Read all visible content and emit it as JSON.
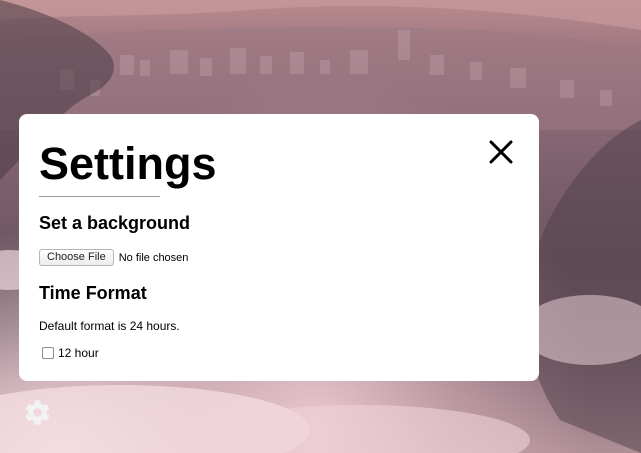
{
  "modal": {
    "title": "Settings",
    "close_icon": "close-icon",
    "background_section": {
      "heading": "Set a background",
      "file_button_label": "Choose File",
      "file_status": "No file chosen"
    },
    "time_section": {
      "heading": "Time Format",
      "description": "Default format is 24 hours.",
      "checkbox_label": "12 hour",
      "checkbox_checked": false
    }
  },
  "settings_button": {
    "icon": "gear-icon"
  },
  "colors": {
    "modal_background": "#ffffff",
    "text": "#000000",
    "gear_icon": "#f2f2f2"
  }
}
